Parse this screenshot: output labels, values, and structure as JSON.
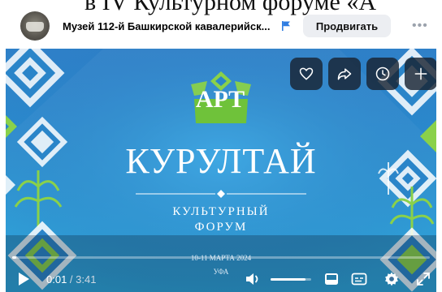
{
  "page": {
    "top_text": "в IV Культурном форуме «А"
  },
  "header": {
    "channel_name": "Музей 112-й Башкирской кавалерийск...",
    "promote_label": "Продвигать",
    "more_label": "•••"
  },
  "player": {
    "actions": [
      "heart-icon",
      "share-icon",
      "clock-icon",
      "plus-icon"
    ],
    "video": {
      "logo_text": "АРТ",
      "title": "КУРУЛТАЙ",
      "subtitle_line1": "КУЛЬТУРНЫЙ",
      "subtitle_line2": "ФОРУМ",
      "dates": "10-11 МАРТА 2024",
      "city": "УФА"
    },
    "controls": {
      "current_time": "0:01",
      "separator": " / ",
      "duration": "3:41",
      "progress_fraction": 0.005,
      "volume_fraction": 0.85,
      "icons": [
        "play-icon",
        "volume-icon",
        "volume-slider",
        "miniplayer-icon",
        "subtitles-icon",
        "settings-icon",
        "fullscreen-icon"
      ]
    },
    "colors": {
      "background_top": "#2f80c8",
      "background_bottom": "#25a3da",
      "ornament_green": "#8ad14a",
      "ornament_white": "#ffffff"
    }
  }
}
